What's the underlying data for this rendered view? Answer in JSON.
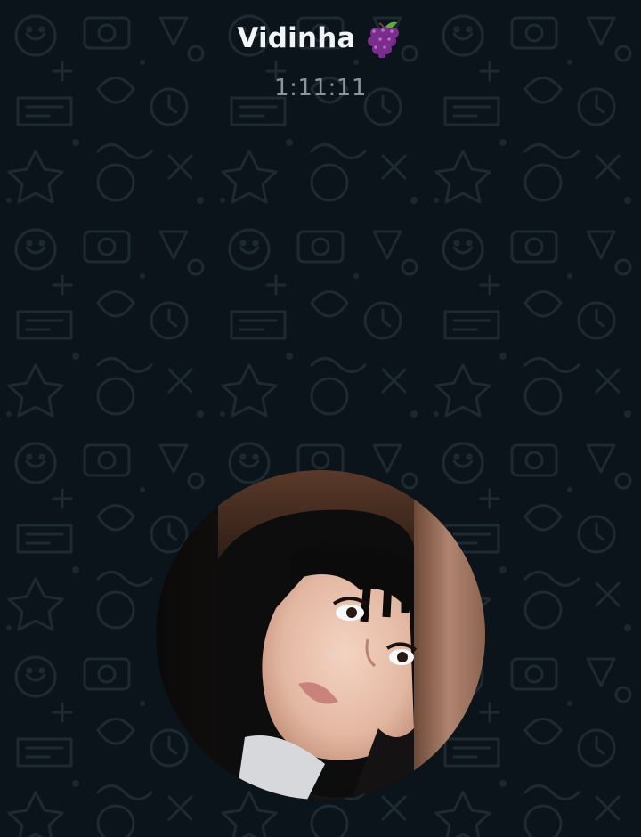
{
  "call": {
    "contact_name": "Vidinha",
    "name_emoji_icon": "grape-emoji-icon",
    "elapsed_time": "1:11:11"
  },
  "background": {
    "pattern": "chat-doodle-wallpaper",
    "base_color": "#0c141b",
    "doodle_color": "#1c2830"
  },
  "avatar": {
    "shape": "circle",
    "description_icon": "contact-photo"
  },
  "colors": {
    "name_text": "#f2f4f5",
    "timer_text": "#8a969e",
    "grape_purple": "#7b2d8e"
  }
}
